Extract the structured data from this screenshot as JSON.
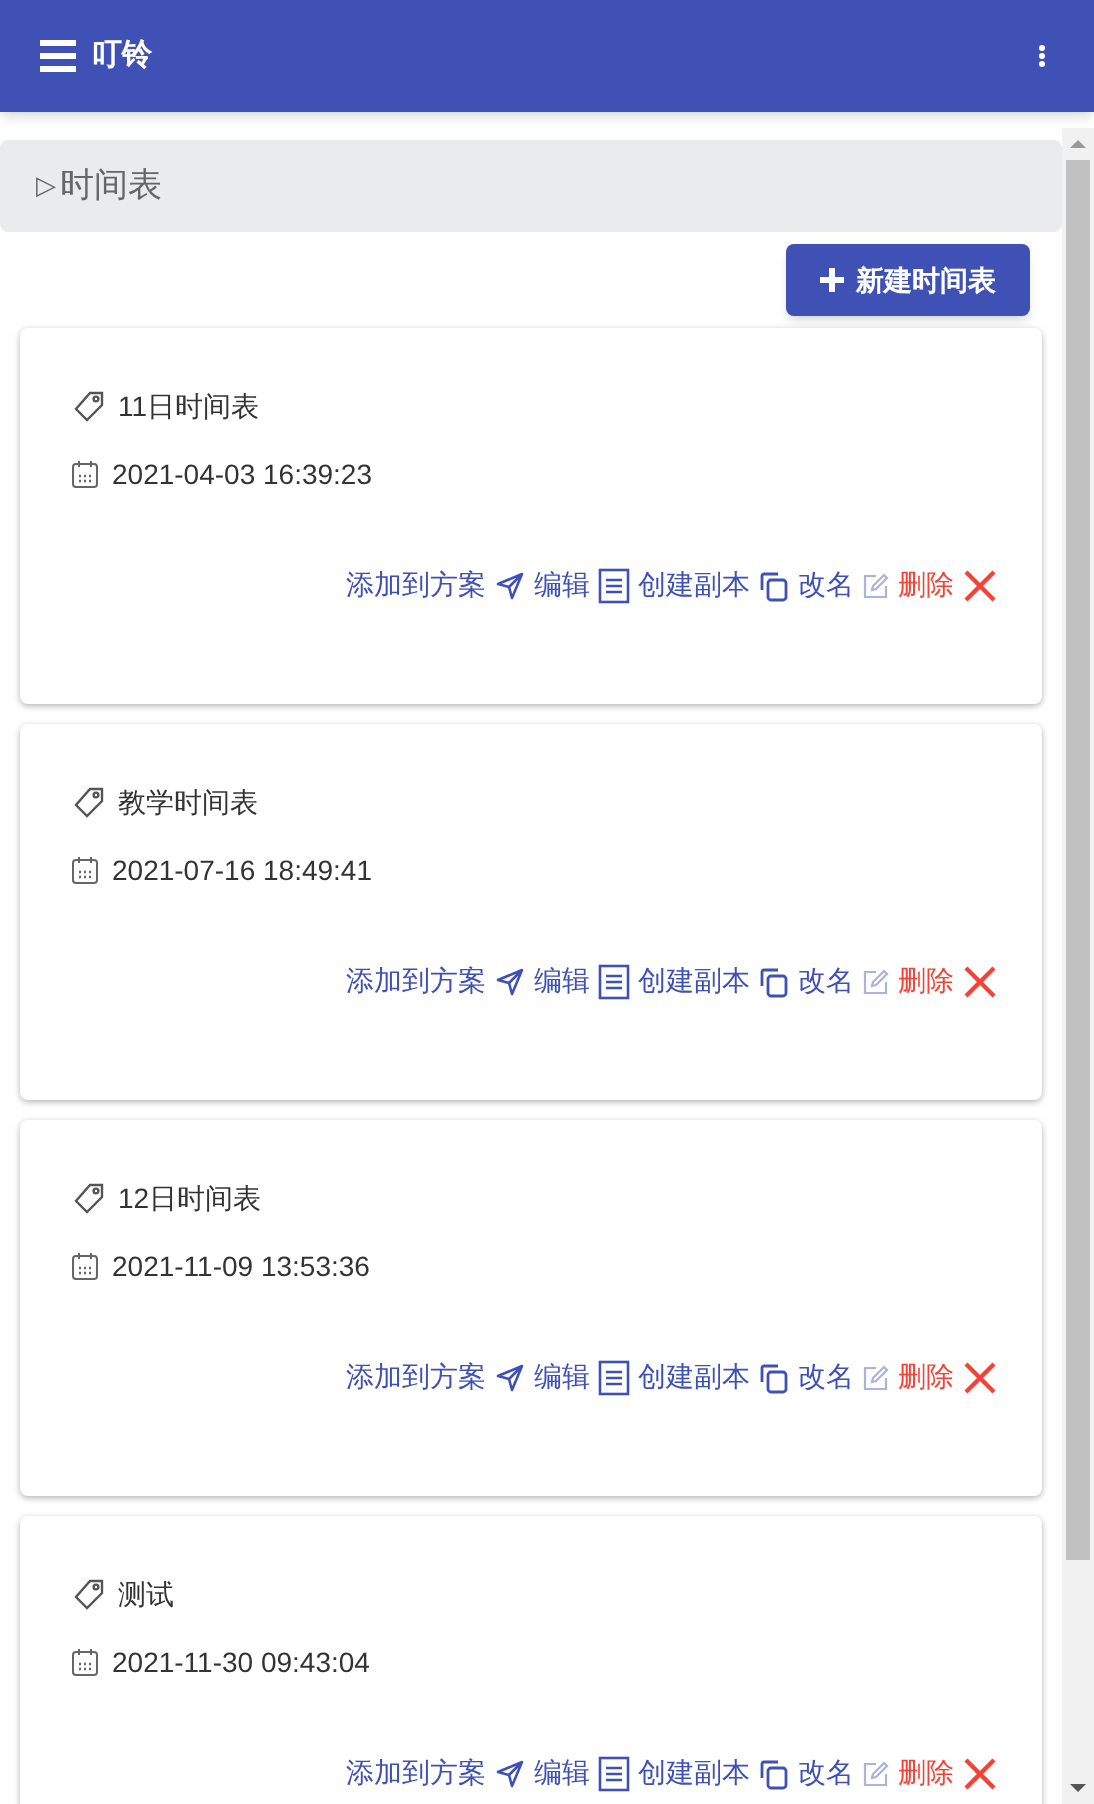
{
  "app_bar": {
    "title": "叮铃"
  },
  "section": {
    "marker": "▷",
    "title": "时间表"
  },
  "new_button": {
    "label": "新建时间表"
  },
  "schedules": [
    {
      "name": "11日时间表",
      "created": "2021-04-03 16:39:23",
      "actions": [
        {
          "kind": "add",
          "label": "添加到方案"
        },
        {
          "kind": "edit",
          "label": "编辑"
        },
        {
          "kind": "copy",
          "label": "创建副本"
        },
        {
          "kind": "rename",
          "label": "改名"
        },
        {
          "kind": "delete",
          "label": "删除"
        }
      ]
    },
    {
      "name": "教学时间表",
      "created": "2021-07-16 18:49:41",
      "actions": [
        {
          "kind": "add",
          "label": "添加到方案"
        },
        {
          "kind": "edit",
          "label": "编辑"
        },
        {
          "kind": "copy",
          "label": "创建副本"
        },
        {
          "kind": "rename",
          "label": "改名"
        },
        {
          "kind": "delete",
          "label": "删除"
        }
      ]
    },
    {
      "name": "12日时间表",
      "created": "2021-11-09 13:53:36",
      "actions": [
        {
          "kind": "add",
          "label": "添加到方案"
        },
        {
          "kind": "edit",
          "label": "编辑"
        },
        {
          "kind": "copy",
          "label": "创建副本"
        },
        {
          "kind": "rename",
          "label": "改名"
        },
        {
          "kind": "delete",
          "label": "删除"
        }
      ]
    },
    {
      "name": "测试",
      "created": "2021-11-30 09:43:04",
      "actions": [
        {
          "kind": "add",
          "label": "添加到方案"
        },
        {
          "kind": "edit",
          "label": "编辑"
        },
        {
          "kind": "copy",
          "label": "创建副本"
        },
        {
          "kind": "rename",
          "label": "改名"
        },
        {
          "kind": "delete",
          "label": "删除"
        }
      ]
    }
  ]
}
